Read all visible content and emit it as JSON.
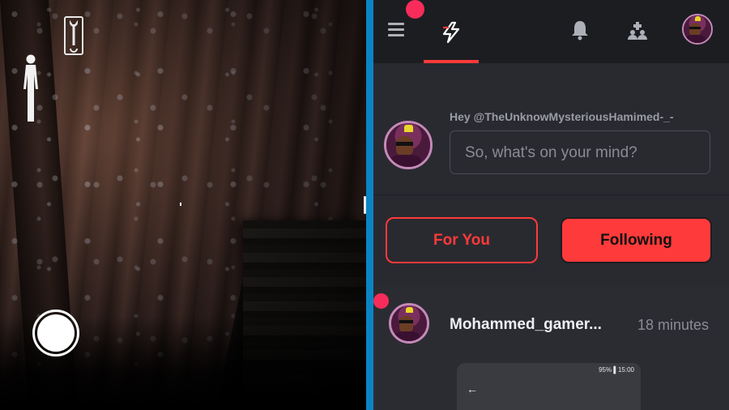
{
  "game": {
    "icons": {
      "tool": "wrench-icon",
      "player": "player-silhouette-icon",
      "action": "action-circle-button"
    }
  },
  "app": {
    "topbar": {
      "menu_icon": "hamburger-menu-icon",
      "home_tab_icon": "lightning-logo-icon",
      "notifications_icon": "bell-icon",
      "people_icon": "group-add-icon",
      "profile_icon": "avatar"
    },
    "composer": {
      "greeting": "Hey @TheUnknowMysteriousHamimed-_-",
      "placeholder": "So, what's on your mind?"
    },
    "feed_tabs": {
      "for_you": "For You",
      "following": "Following",
      "active": "Following"
    },
    "post": {
      "username": "Mohammed_gamer...",
      "time": "18 minutes",
      "image_statusbar": "95% ▌15:00",
      "image_back_arrow": "←"
    },
    "colors": {
      "accent": "#ff3a3a",
      "notification_dot": "#f72c5b",
      "background": "#292a30",
      "topbar": "#1c1d21",
      "divider": "#0b84c4"
    }
  }
}
